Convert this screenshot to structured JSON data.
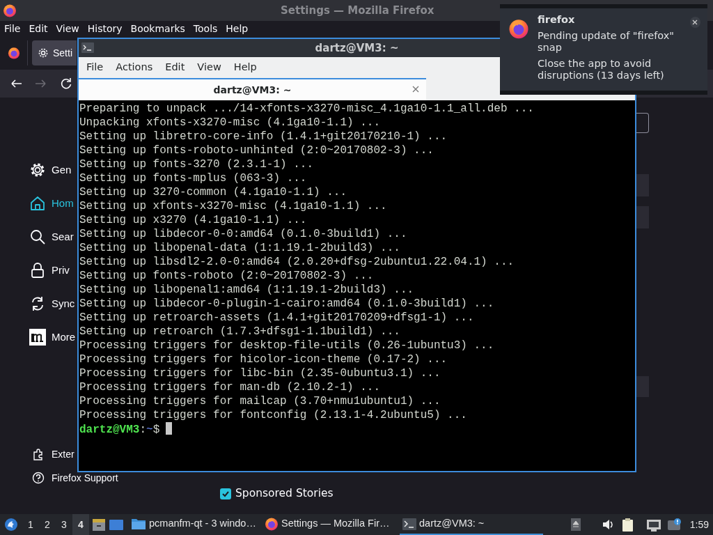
{
  "firefox": {
    "title": "Settings — Mozilla Firefox",
    "menu": [
      "File",
      "Edit",
      "View",
      "History",
      "Bookmarks",
      "Tools",
      "Help"
    ],
    "tab": {
      "label": "Setti"
    },
    "sidebar": {
      "items": [
        {
          "label": "Gen",
          "selected": false
        },
        {
          "label": "Hom",
          "selected": true
        },
        {
          "label": "Sear",
          "selected": false
        },
        {
          "label": "Priv",
          "selected": false
        },
        {
          "label": "Sync",
          "selected": false
        },
        {
          "label": "More",
          "selected": false
        }
      ],
      "footer": [
        "Exter",
        "Firefox Support"
      ]
    },
    "sponsored": {
      "label": "Sponsored Stories",
      "checked": true
    }
  },
  "terminal": {
    "title": "dartz@VM3: ~",
    "menu": [
      "File",
      "Actions",
      "Edit",
      "View",
      "Help"
    ],
    "tab": {
      "label": "dartz@VM3: ~"
    },
    "lines": [
      "Preparing to unpack .../14-xfonts-x3270-misc_4.1ga10-1.1_all.deb ...",
      "Unpacking xfonts-x3270-misc (4.1ga10-1.1) ...",
      "Setting up libretro-core-info (1.4.1+git20170210-1) ...",
      "Setting up fonts-roboto-unhinted (2:0~20170802-3) ...",
      "Setting up fonts-3270 (2.3.1-1) ...",
      "Setting up fonts-mplus (063-3) ...",
      "Setting up 3270-common (4.1ga10-1.1) ...",
      "Setting up xfonts-x3270-misc (4.1ga10-1.1) ...",
      "Setting up x3270 (4.1ga10-1.1) ...",
      "Setting up libdecor-0-0:amd64 (0.1.0-3build1) ...",
      "Setting up libopenal-data (1:1.19.1-2build3) ...",
      "Setting up libsdl2-2.0-0:amd64 (2.0.20+dfsg-2ubuntu1.22.04.1) ...",
      "Setting up fonts-roboto (2:0~20170802-3) ...",
      "Setting up libopenal1:amd64 (1:1.19.1-2build3) ...",
      "Setting up libdecor-0-plugin-1-cairo:amd64 (0.1.0-3build1) ...",
      "Setting up retroarch-assets (1.4.1+git20170209+dfsg1-1) ...",
      "Setting up retroarch (1.7.3+dfsg1-1.1build1) ...",
      "Processing triggers for desktop-file-utils (0.26-1ubuntu3) ...",
      "Processing triggers for hicolor-icon-theme (0.17-2) ...",
      "Processing triggers for libc-bin (2.35-0ubuntu3.1) ...",
      "Processing triggers for man-db (2.10.2-1) ...",
      "Processing triggers for mailcap (3.70+nmu1ubuntu1) ...",
      "Processing triggers for fontconfig (2.13.1-4.2ubuntu5) ..."
    ],
    "prompt": {
      "user": "dartz@VM3",
      "separator": ":",
      "path": "~",
      "sign": "$"
    }
  },
  "notification": {
    "app": "firefox",
    "summary": "Pending update of \"firefox\" snap",
    "body": "Close the app to avoid disruptions (13 days left)"
  },
  "taskbar": {
    "workspaces": [
      {
        "label": "1",
        "selected": false
      },
      {
        "label": "2",
        "selected": false
      },
      {
        "label": "3",
        "selected": false
      },
      {
        "label": "4",
        "selected": true
      }
    ],
    "tasks": [
      {
        "label": "pcmanfm-qt - 3 windo…",
        "active": false
      },
      {
        "label": "Settings — Mozilla Fir…",
        "active": false
      },
      {
        "label": "dartz@VM3: ~",
        "active": true
      }
    ],
    "clock": "1:59"
  }
}
